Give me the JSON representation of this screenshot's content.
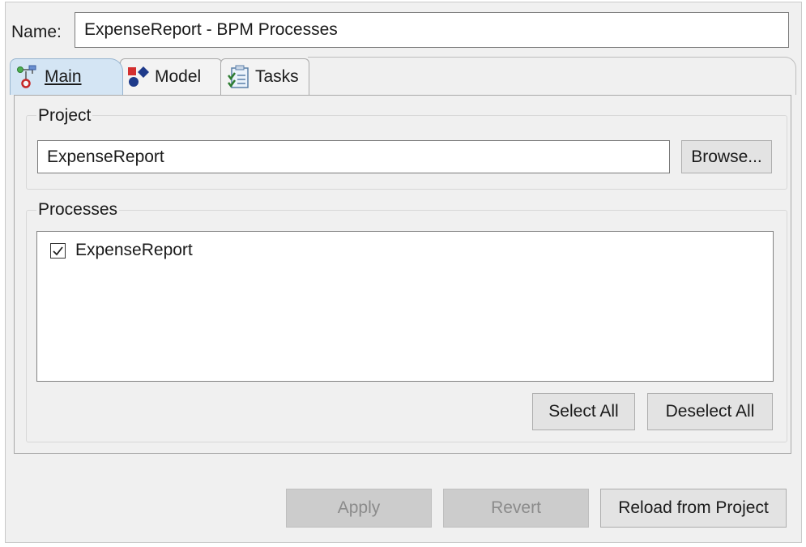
{
  "name_field": {
    "label": "Name:",
    "value": "ExpenseReport - BPM Processes"
  },
  "tabs": [
    {
      "label": "Main",
      "icon": "main-config-icon",
      "selected": true
    },
    {
      "label": "Model",
      "icon": "model-shapes-icon",
      "selected": false
    },
    {
      "label": "Tasks",
      "icon": "tasks-clipboard-icon",
      "selected": false
    }
  ],
  "project_group": {
    "title": "Project",
    "value": "ExpenseReport",
    "browse_label": "Browse..."
  },
  "processes_group": {
    "title": "Processes",
    "items": [
      {
        "label": "ExpenseReport",
        "checked": true
      }
    ],
    "select_all_label": "Select All",
    "deselect_all_label": "Deselect All"
  },
  "footer": {
    "apply_label": "Apply",
    "revert_label": "Revert",
    "reload_label": "Reload from Project"
  },
  "colors": {
    "selected_tab": "#d4e5f4",
    "panel_bg": "#f0f0f0",
    "button_bg": "#e3e3e3",
    "disabled_button_bg": "#cccccc"
  }
}
